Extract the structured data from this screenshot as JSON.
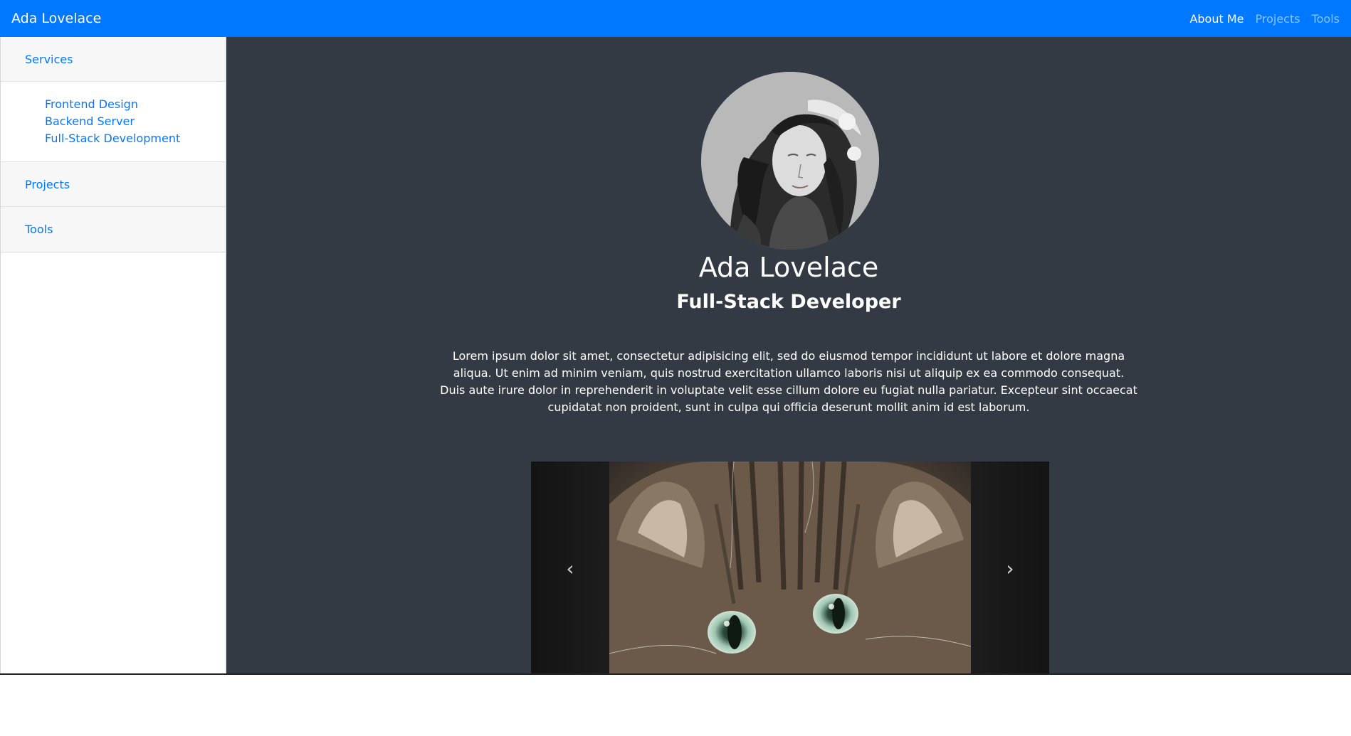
{
  "navbar": {
    "brand": "Ada Lovelace",
    "links": [
      {
        "label": "About Me",
        "active": true
      },
      {
        "label": "Projects",
        "active": false
      },
      {
        "label": "Tools",
        "active": false
      }
    ]
  },
  "sidebar": {
    "sections": [
      {
        "label": "Services",
        "items": [
          "Frontend Design",
          "Backend Server",
          "Full-Stack Development"
        ]
      },
      {
        "label": "Projects"
      },
      {
        "label": "Tools"
      }
    ]
  },
  "profile": {
    "name": "Ada Lovelace",
    "role": "Full-Stack Developer",
    "bio": "Lorem ipsum dolor sit amet, consectetur adipisicing elit, sed do eiusmod tempor incididunt ut labore et dolore magna aliqua. Ut enim ad minim veniam, quis nostrud exercitation ullamco laboris nisi ut aliquip ex ea commodo consequat. Duis aute irure dolor in reprehenderit in voluptate velit esse cillum dolore eu fugiat nulla pariatur. Excepteur sint occaecat cupidatat non proident, sunt in culpa qui officia deserunt mollit anim id est laborum."
  },
  "carousel": {
    "prev_icon": "chevron-left-icon",
    "next_icon": "chevron-right-icon",
    "prev_glyph": "‹",
    "next_glyph": "›"
  },
  "colors": {
    "navbar": "#0078ff",
    "main_bg": "#343a43",
    "link": "#0078ff"
  }
}
